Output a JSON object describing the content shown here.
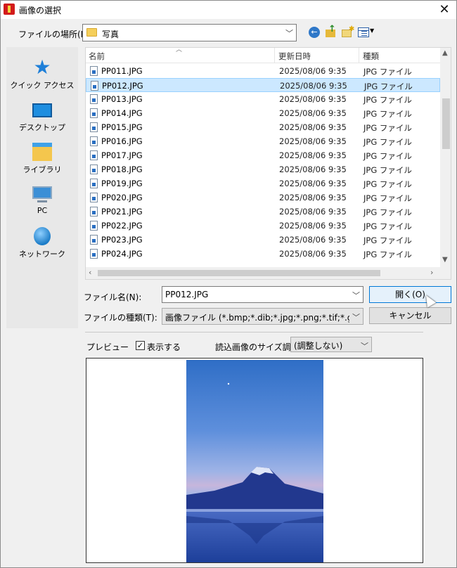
{
  "window": {
    "title": "画像の選択",
    "close_glyph": "✕"
  },
  "toolbar": {
    "look_in_label": "ファイルの場所(I):",
    "look_in_value": "写真",
    "icons": [
      "back-icon",
      "up-folder-icon",
      "new-folder-icon",
      "view-menu-icon"
    ]
  },
  "places": [
    {
      "label": "クイック アクセス",
      "icon": "star-icon"
    },
    {
      "label": "デスクトップ",
      "icon": "desktop-icon"
    },
    {
      "label": "ライブラリ",
      "icon": "library-icon"
    },
    {
      "label": "PC",
      "icon": "pc-icon"
    },
    {
      "label": "ネットワーク",
      "icon": "network-icon"
    }
  ],
  "file_list": {
    "columns": [
      "名前",
      "更新日時",
      "種類"
    ],
    "rows": [
      {
        "name": "PP011.JPG",
        "date": "2025/08/06 9:35",
        "type": "JPG ファイル"
      },
      {
        "name": "PP012.JPG",
        "date": "2025/08/06 9:35",
        "type": "JPG ファイル",
        "selected": true
      },
      {
        "name": "PP013.JPG",
        "date": "2025/08/06 9:35",
        "type": "JPG ファイル"
      },
      {
        "name": "PP014.JPG",
        "date": "2025/08/06 9:35",
        "type": "JPG ファイル"
      },
      {
        "name": "PP015.JPG",
        "date": "2025/08/06 9:35",
        "type": "JPG ファイル"
      },
      {
        "name": "PP016.JPG",
        "date": "2025/08/06 9:35",
        "type": "JPG ファイル"
      },
      {
        "name": "PP017.JPG",
        "date": "2025/08/06 9:35",
        "type": "JPG ファイル"
      },
      {
        "name": "PP018.JPG",
        "date": "2025/08/06 9:35",
        "type": "JPG ファイル"
      },
      {
        "name": "PP019.JPG",
        "date": "2025/08/06 9:35",
        "type": "JPG ファイル"
      },
      {
        "name": "PP020.JPG",
        "date": "2025/08/06 9:35",
        "type": "JPG ファイル"
      },
      {
        "name": "PP021.JPG",
        "date": "2025/08/06 9:35",
        "type": "JPG ファイル"
      },
      {
        "name": "PP022.JPG",
        "date": "2025/08/06 9:35",
        "type": "JPG ファイル"
      },
      {
        "name": "PP023.JPG",
        "date": "2025/08/06 9:35",
        "type": "JPG ファイル"
      },
      {
        "name": "PP024.JPG",
        "date": "2025/08/06 9:35",
        "type": "JPG ファイル"
      }
    ]
  },
  "form": {
    "filename_label": "ファイル名(N):",
    "filename_value": "PP012.JPG",
    "filetype_label": "ファイルの種類(T):",
    "filetype_value": "画像ファイル (*.bmp;*.dib;*.jpg;*.png;*.tif;*.gif;*.psd;",
    "open_button": "開く(O)",
    "cancel_button": "キャンセル"
  },
  "preview": {
    "label": "プレビュー",
    "show_checkbox_label": "表示する",
    "show_checked": true,
    "resize_label": "読込画像のサイズ調",
    "resize_value": "(調整しない)"
  }
}
